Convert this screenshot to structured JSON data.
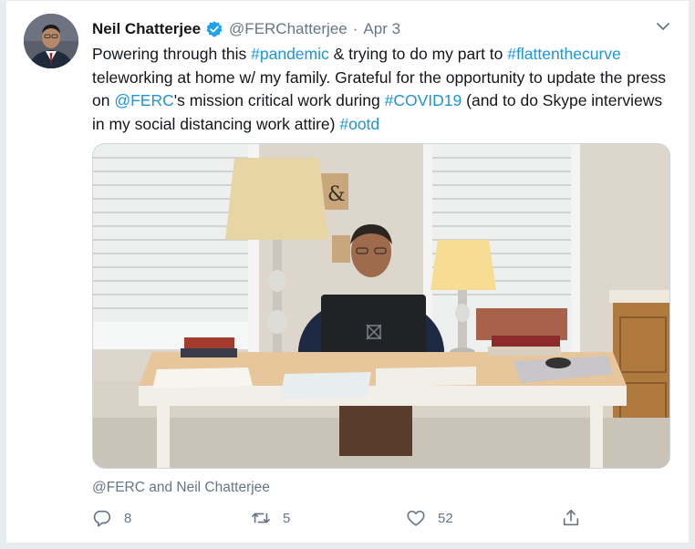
{
  "tweet": {
    "author_name": "Neil Chatterjee",
    "handle": "@FERChatterjee",
    "separator": "·",
    "date": "Apr 3",
    "text_segments": [
      {
        "text": "Powering through this ",
        "link": false
      },
      {
        "text": "#pandemic",
        "link": true
      },
      {
        "text": " & trying to do my part to ",
        "link": false
      },
      {
        "text": "#flattenthecurve",
        "link": true
      },
      {
        "text": " teleworking at home w/ my family. Grateful for the opportunity to update the press on ",
        "link": false
      },
      {
        "text": "@FERC",
        "link": true
      },
      {
        "text": "'s mission critical work during ",
        "link": false
      },
      {
        "text": "#COVID19",
        "link": true
      },
      {
        "text": " (and to do Skype interviews in my social distancing work attire) ",
        "link": false
      },
      {
        "text": "#ootd",
        "link": true
      }
    ],
    "attribution": "@FERC and Neil Chatterjee",
    "actions": {
      "replies": "8",
      "retweets": "5",
      "likes": "52"
    }
  },
  "colors": {
    "link": "#1b95e0",
    "secondary": "#657786",
    "verified": "#1da1f2"
  },
  "icons": [
    "verified-badge-icon",
    "chevron-down-icon",
    "reply-icon",
    "retweet-icon",
    "like-icon",
    "share-icon"
  ]
}
